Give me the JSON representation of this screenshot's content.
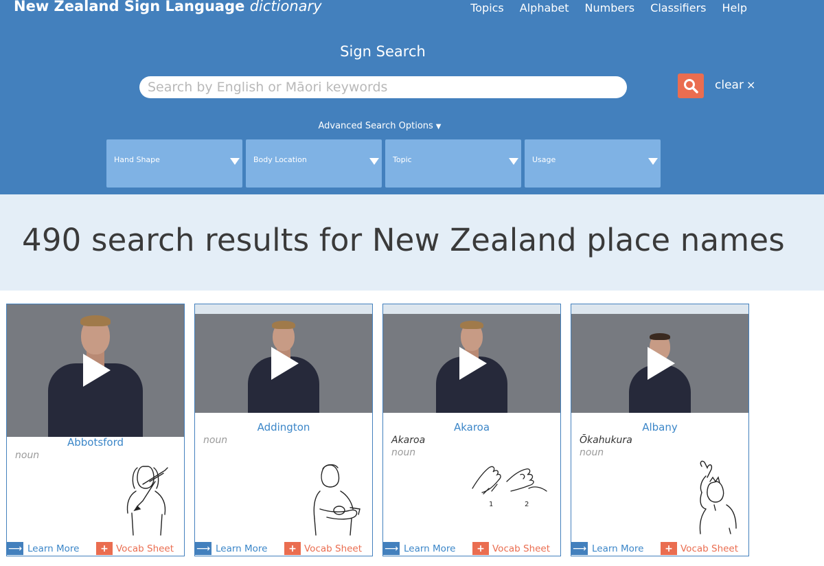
{
  "header": {
    "brand_bold": "New Zealand Sign Language",
    "brand_italic": "dictionary",
    "nav": [
      "Topics",
      "Alphabet",
      "Numbers",
      "Classifiers",
      "Help"
    ]
  },
  "search": {
    "title": "Sign Search",
    "placeholder": "Search by English or Māori keywords",
    "value": "",
    "clear_label": "clear",
    "clear_icon": "×",
    "advanced_label": "Advanced Search Options",
    "advanced_icon": "▼"
  },
  "filters": [
    {
      "label": "Hand Shape"
    },
    {
      "label": "Body Location"
    },
    {
      "label": "Topic"
    },
    {
      "label": "Usage"
    }
  ],
  "results": {
    "heading": "490 search results for New Zealand place names"
  },
  "cards": [
    {
      "word": "Abbotsford",
      "maori": "",
      "pos": "noun",
      "learn_label": "Learn More",
      "vocab_label": "Vocab Sheet"
    },
    {
      "word": "Addington",
      "maori": "",
      "pos": "noun",
      "learn_label": "Learn More",
      "vocab_label": "Vocab Sheet"
    },
    {
      "word": "Akaroa",
      "maori": "Akaroa",
      "pos": "noun",
      "learn_label": "Learn More",
      "vocab_label": "Vocab Sheet",
      "step_labels": [
        "1",
        "2"
      ]
    },
    {
      "word": "Albany",
      "maori": "Ōkahukura",
      "pos": "noun",
      "learn_label": "Learn More",
      "vocab_label": "Vocab Sheet"
    }
  ],
  "colors": {
    "header_bg": "#4380bd",
    "filter_bg": "#7fb2e4",
    "accent_orange": "#ea6d50",
    "link_blue": "#3b86c8",
    "results_band_bg": "#e4eef7"
  },
  "icons": {
    "search": "search-icon",
    "arrow": "arrow-right-icon",
    "plus": "plus-icon",
    "play": "play-icon",
    "caret": "caret-down-icon"
  }
}
